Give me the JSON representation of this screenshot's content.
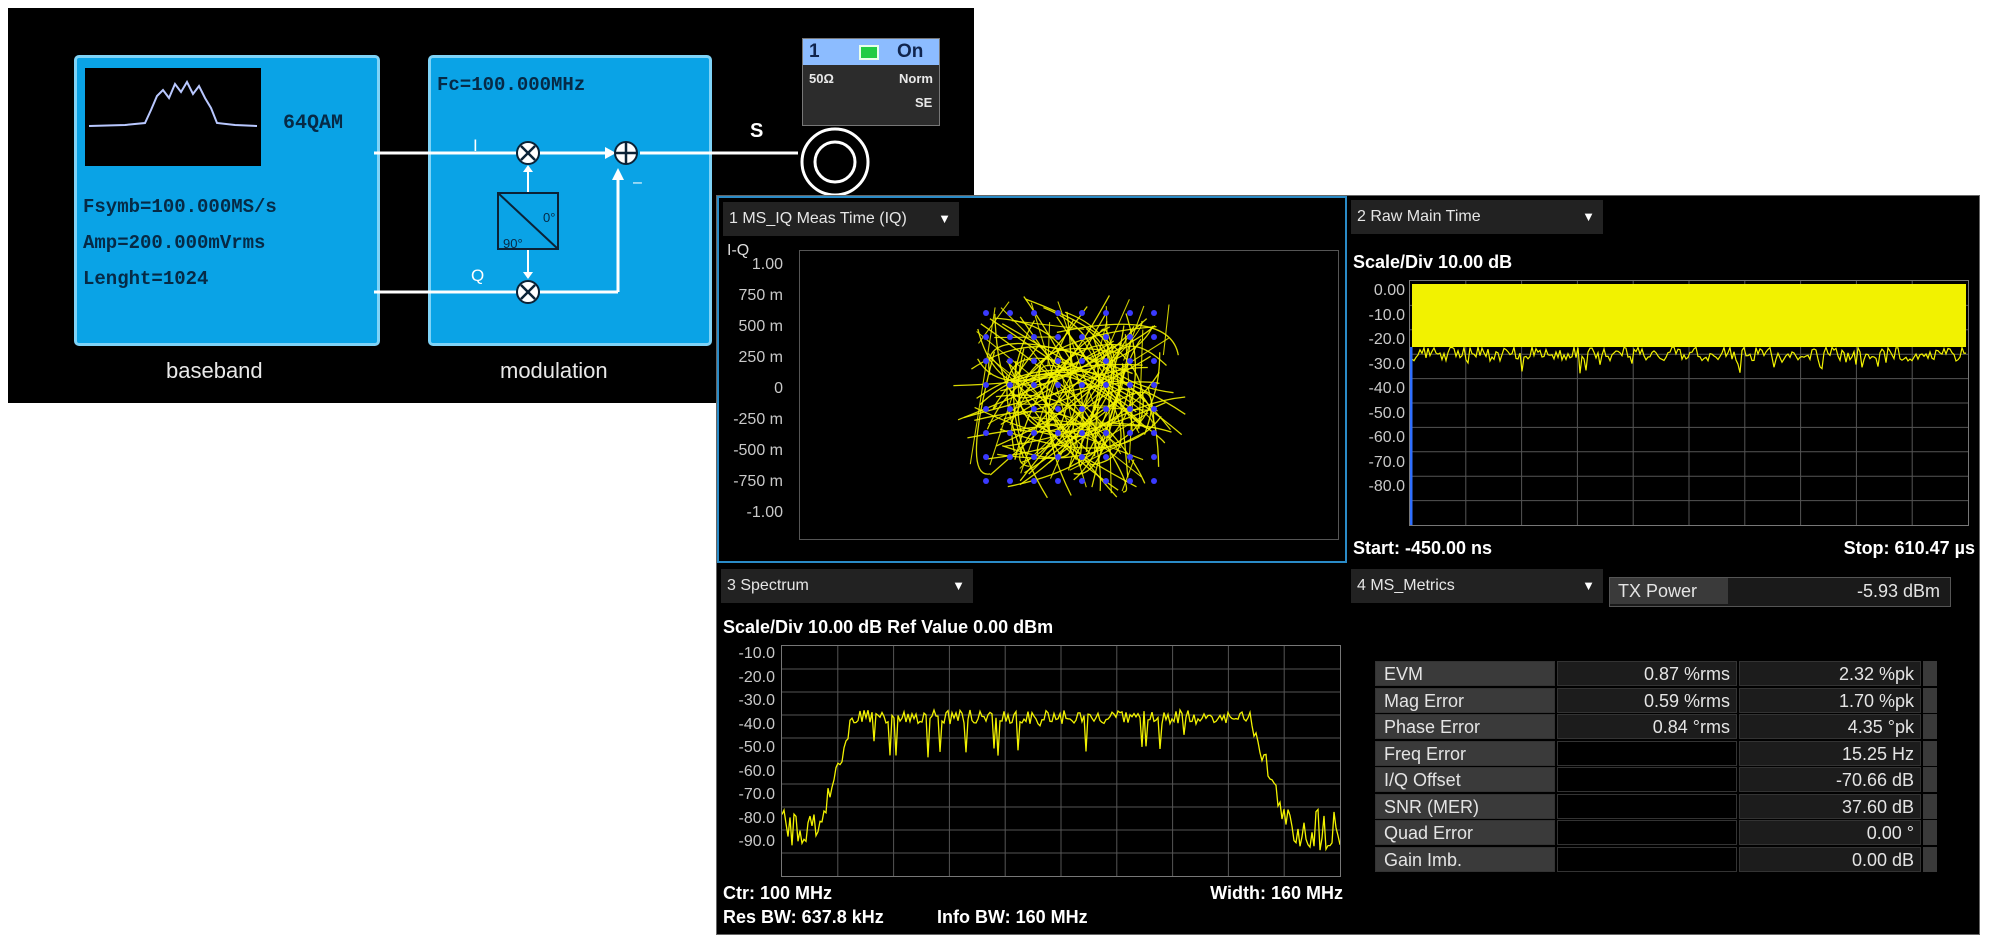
{
  "diagram": {
    "baseband": {
      "modulation_type": "64QAM",
      "fsymb": "Fsymb=100.000MS/s",
      "amp": "Amp=200.000mVrms",
      "length": "Lenght=1024",
      "caption": "baseband"
    },
    "modulator": {
      "fc": "Fc=100.000MHz",
      "i_label": "I",
      "q_label": "Q",
      "phase_0": "0°",
      "phase_90": "90°",
      "minus": "–",
      "caption": "modulation"
    },
    "output": {
      "port_label": "S",
      "channel": "1",
      "state": "On",
      "impedance": "50Ω",
      "mode": "Norm",
      "type": "SE"
    }
  },
  "analyzer": {
    "iq_panel": {
      "title": "1 MS_IQ Meas Time (IQ)",
      "label": "I-Q",
      "y_ticks": [
        "1.00",
        "750 m",
        "500 m",
        "250 m",
        "0",
        "-250 m",
        "-500 m",
        "-750 m",
        "-1.00"
      ]
    },
    "time_panel": {
      "title": "2 Raw Main Time",
      "scale": "Scale/Div 10.00 dB",
      "y_ticks": [
        "0.00",
        "-10.0",
        "-20.0",
        "-30.0",
        "-40.0",
        "-50.0",
        "-60.0",
        "-70.0",
        "-80.0"
      ],
      "start": "Start: -450.00 ns",
      "stop": "Stop: 610.47 µs"
    },
    "spectrum_panel": {
      "title": "3 Spectrum",
      "scale": "Scale/Div 10.00 dB Ref Value 0.00 dBm",
      "y_ticks": [
        "-10.0",
        "-20.0",
        "-30.0",
        "-40.0",
        "-50.0",
        "-60.0",
        "-70.0",
        "-80.0",
        "-90.0"
      ],
      "center": "Ctr: 100 MHz",
      "width": "Width: 160 MHz",
      "res_bw": "Res BW: 637.8 kHz",
      "info_bw": "Info BW: 160 MHz"
    },
    "metrics_panel": {
      "title": "4 MS_Metrics",
      "tx_power_label": "TX Power",
      "tx_power_value": "-5.93 dBm",
      "rows": [
        {
          "name": "EVM",
          "rms": "0.87 %rms",
          "pk": "2.32 %pk"
        },
        {
          "name": "Mag Error",
          "rms": "0.59 %rms",
          "pk": "1.70 %pk"
        },
        {
          "name": "Phase Error",
          "rms": "0.84 °rms",
          "pk": "4.35 °pk"
        },
        {
          "name": "Freq Error",
          "rms": "",
          "pk": "15.25 Hz"
        },
        {
          "name": "I/Q Offset",
          "rms": "",
          "pk": "-70.66 dB"
        },
        {
          "name": "SNR (MER)",
          "rms": "",
          "pk": "37.60 dB"
        },
        {
          "name": "Quad Error",
          "rms": "",
          "pk": "0.00 °"
        },
        {
          "name": "Gain Imb.",
          "rms": "",
          "pk": "0.00 dB"
        }
      ]
    }
  },
  "colors": {
    "block_fill": "#0aa3e6",
    "trace": "#f2f200",
    "constellation_points": "#3a3aff",
    "marker_blue": "#2f6fff",
    "channel_on": "#22cc44"
  },
  "icons": [
    "mixer-icon",
    "adder-icon",
    "phase-shifter-icon",
    "output-connector-icon",
    "dropdown-icon"
  ]
}
